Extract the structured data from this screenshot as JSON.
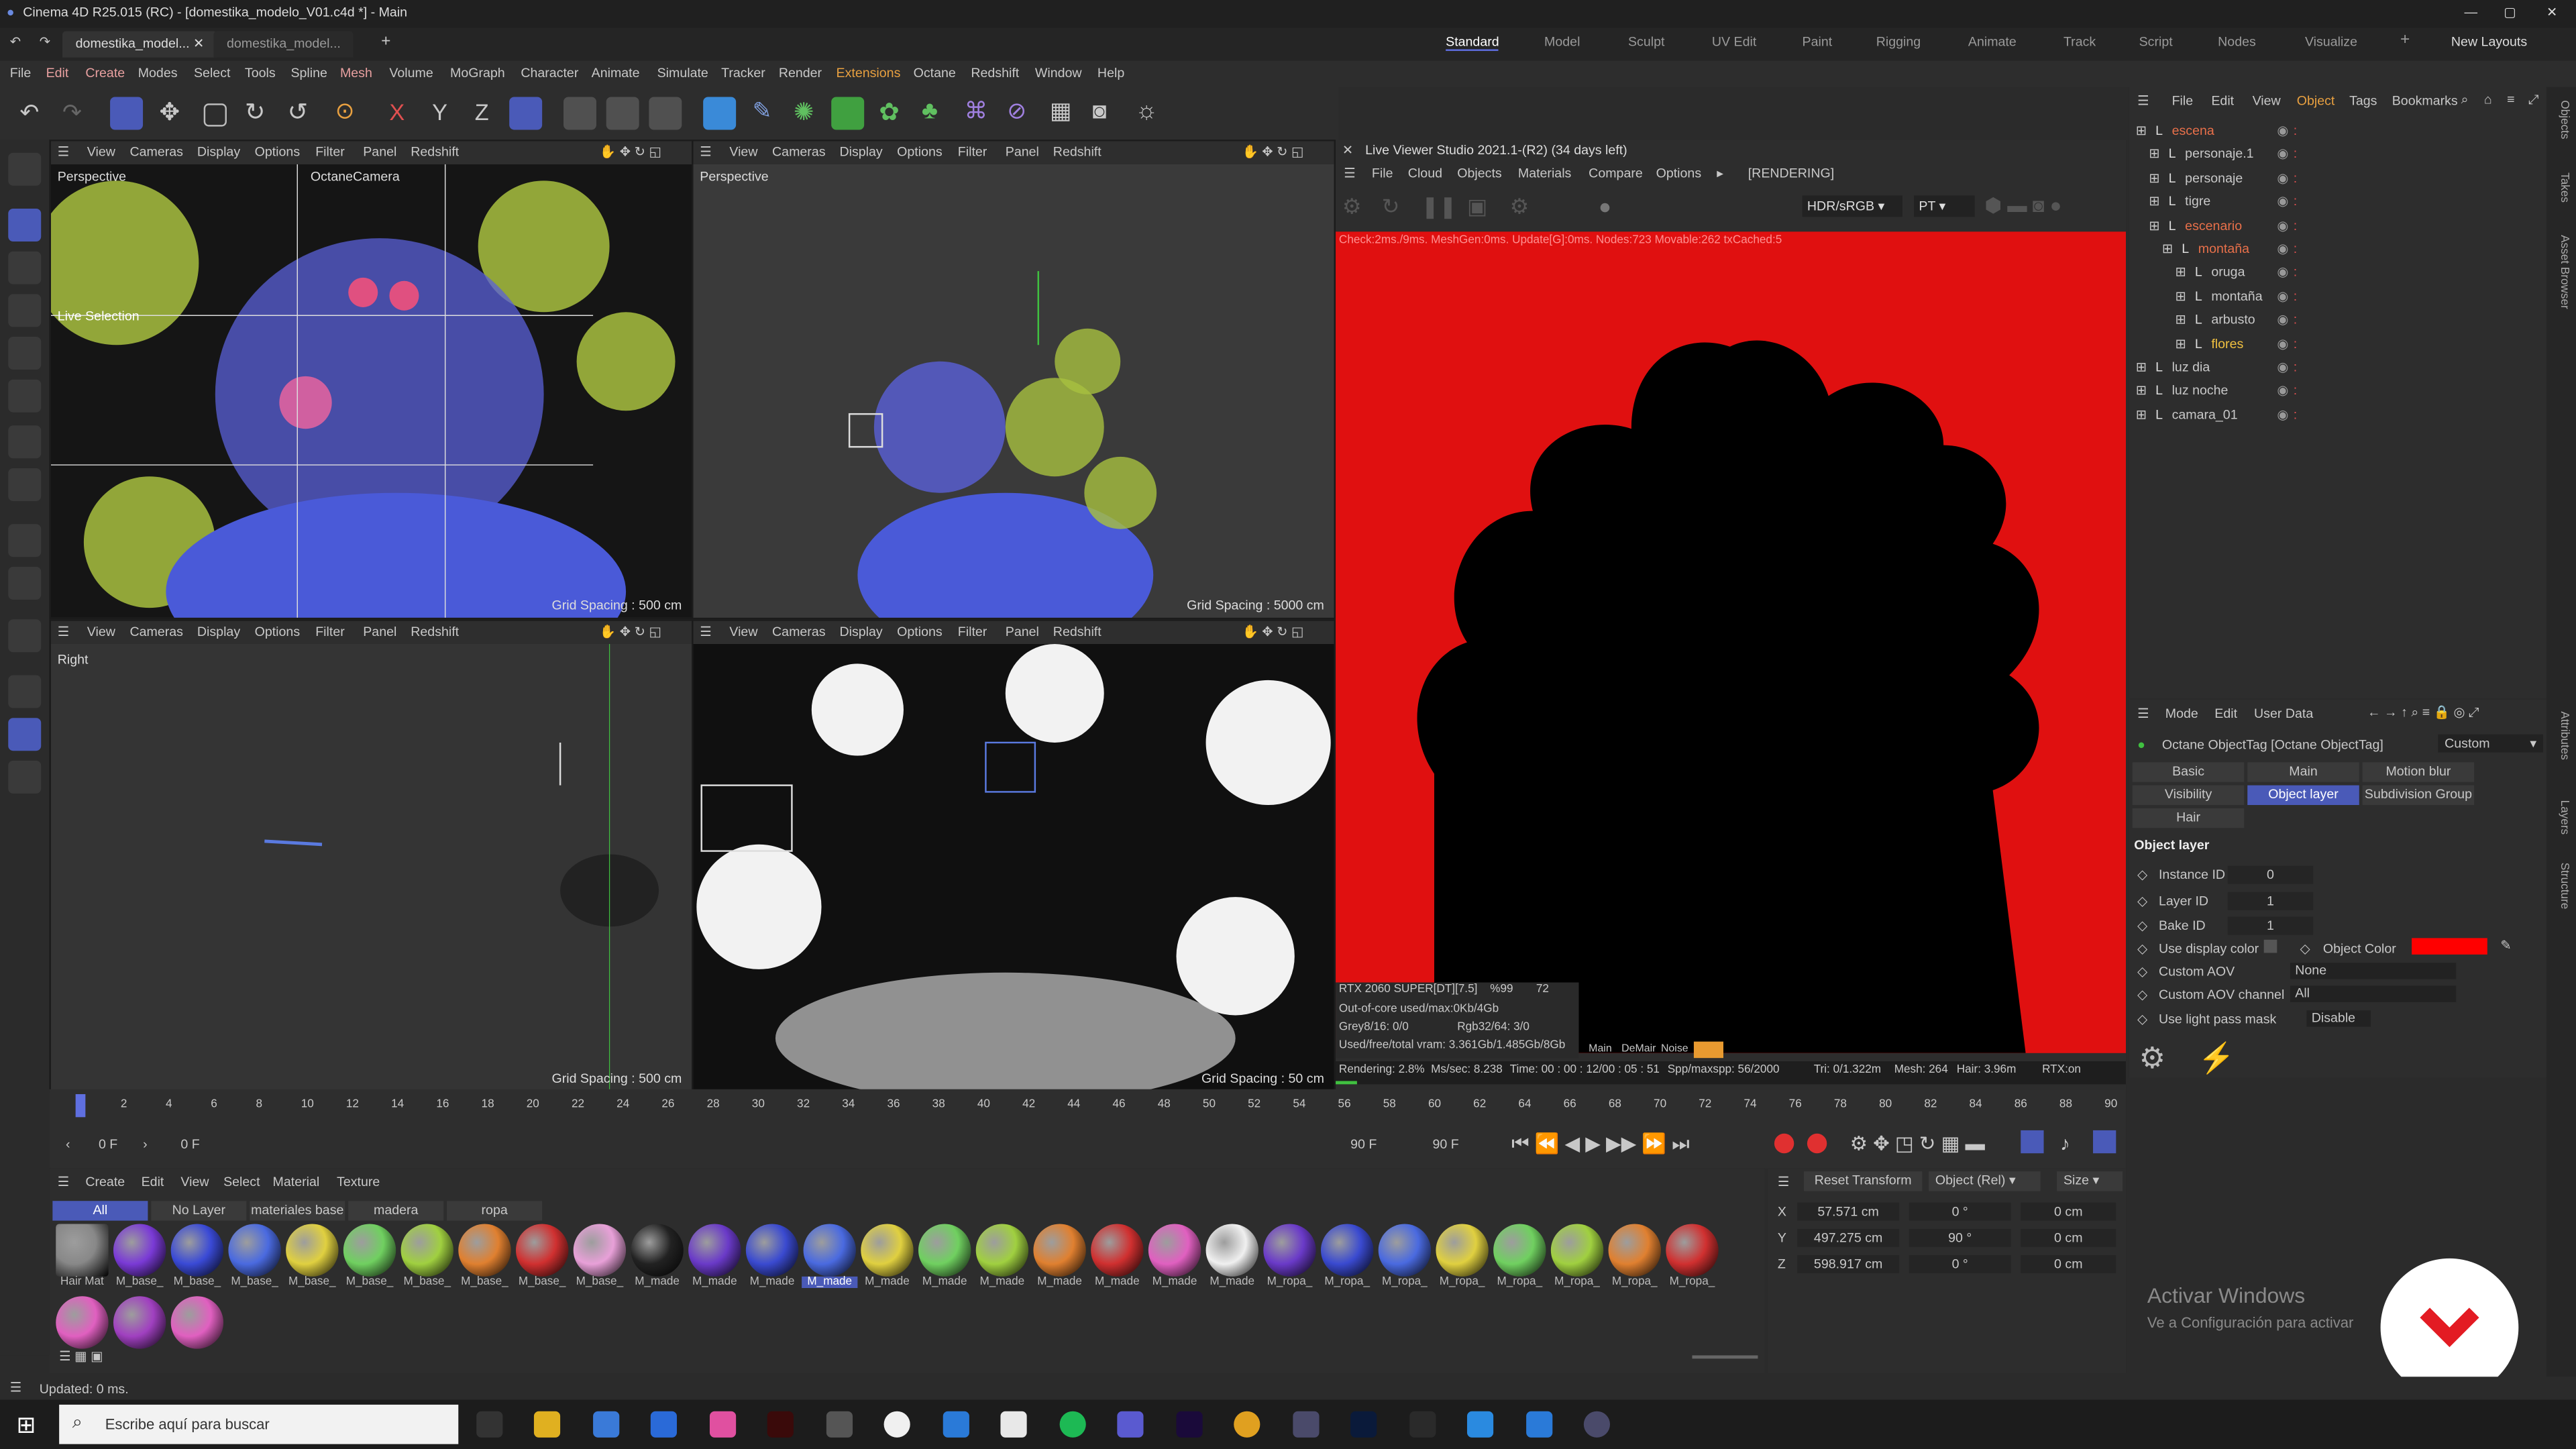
{
  "window": {
    "title": "Cinema 4D R25.015 (RC) - [domestika_modelo_V01.c4d *] - Main"
  },
  "doc_tabs": [
    "domestika_model...",
    "domestika_model..."
  ],
  "layouts": [
    "Standard",
    "Model",
    "Sculpt",
    "UV Edit",
    "Paint",
    "Rigging",
    "Animate",
    "Track",
    "Script",
    "Nodes",
    "Visualize",
    "New Layouts"
  ],
  "menu": [
    "File",
    "Edit",
    "Create",
    "Modes",
    "Select",
    "Tools",
    "Spline",
    "Mesh",
    "Volume",
    "MoGraph",
    "Character",
    "Animate",
    "Simulate",
    "Tracker",
    "Render",
    "Extensions",
    "Octane",
    "Redshift",
    "Window",
    "Help"
  ],
  "viewport_menu": [
    "View",
    "Cameras",
    "Display",
    "Options",
    "Filter",
    "Panel",
    "Redshift"
  ],
  "viewports": [
    {
      "label": "Perspective",
      "camera": "OctaneCamera",
      "grid": "Grid Spacing : 500 cm",
      "hint": "Live Selection"
    },
    {
      "label": "Perspective",
      "grid": "Grid Spacing : 5000 cm"
    },
    {
      "label": "Right",
      "grid": "Grid Spacing : 500 cm"
    },
    {
      "label": "",
      "grid": "Grid Spacing : 50 cm"
    }
  ],
  "lvs": {
    "title": "Live Viewer Studio 2021.1-(R2) (34 days left)",
    "menu": [
      "File",
      "Cloud",
      "Objects",
      "Materials",
      "Compare",
      "Options"
    ],
    "status": "[RENDERING]",
    "colorspace": "HDR/sRGB",
    "mode": "PT",
    "check": "Check:2ms./9ms. MeshGen:0ms. Update[G]:0ms. Nodes:723 Movable:262 txCached:5",
    "gpu": "RTX 2060 SUPER[DT][7.5]",
    "gpu_pct": "%99",
    "gpu_temp": "72",
    "outofcore": "Out-of-core used/max:0Kb/4Gb",
    "grey": "Grey8/16: 0/0",
    "rgb": "Rgb32/64: 3/0",
    "vram": "Used/free/total vram: 3.361Gb/1.485Gb/8Gb",
    "modes": [
      "Main",
      "DeMair",
      "Noise"
    ],
    "rendering": "Rendering: 2.8%",
    "mssec": "Ms/sec: 8.238",
    "time": "Time: 00 : 00 : 12/00 : 05 : 51",
    "spp": "Spp/maxspp: 56/2000",
    "tri": "Tri: 0/1.322m",
    "mesh": "Mesh: 264",
    "hair": "Hair: 3.96m",
    "rtx": "RTX:on"
  },
  "objmgr": {
    "menu": [
      "File",
      "Edit",
      "View",
      "Object",
      "Tags",
      "Bookmarks"
    ],
    "items": [
      {
        "name": "escena",
        "indent": 0,
        "color": "#e8704a"
      },
      {
        "name": "personaje.1",
        "indent": 1,
        "color": "#c8c8c8"
      },
      {
        "name": "personaje",
        "indent": 1,
        "color": "#c8c8c8"
      },
      {
        "name": "tigre",
        "indent": 1,
        "color": "#c8c8c8"
      },
      {
        "name": "escenario",
        "indent": 1,
        "color": "#e8704a"
      },
      {
        "name": "montaña",
        "indent": 2,
        "color": "#e8704a"
      },
      {
        "name": "oruga",
        "indent": 3,
        "color": "#c8c8c8"
      },
      {
        "name": "montaña",
        "indent": 3,
        "color": "#c8c8c8"
      },
      {
        "name": "arbusto",
        "indent": 3,
        "color": "#c8c8c8"
      },
      {
        "name": "flores",
        "indent": 3,
        "color": "#f0c040"
      },
      {
        "name": "luz dia",
        "indent": 0,
        "color": "#c8c8c8"
      },
      {
        "name": "luz noche",
        "indent": 0,
        "color": "#c8c8c8"
      },
      {
        "name": "camara_01",
        "indent": 0,
        "color": "#c8c8c8"
      }
    ]
  },
  "attr": {
    "menu": [
      "Mode",
      "Edit",
      "User Data"
    ],
    "tag": "Octane ObjectTag [Octane ObjectTag]",
    "preset": "Custom",
    "tabs": [
      "Basic",
      "Main",
      "Motion blur",
      "Visibility",
      "Object layer",
      "Subdivision Group",
      "Hair"
    ],
    "section": "Object layer",
    "fields": [
      {
        "label": "Instance ID",
        "value": "0"
      },
      {
        "label": "Layer ID",
        "value": "1"
      },
      {
        "label": "Bake ID",
        "value": "1"
      }
    ],
    "use_display_color": "Use display color",
    "object_color": "Object Color",
    "custom_aov": "Custom AOV",
    "custom_aov_value": "None",
    "custom_aov_channel": "Custom AOV channel",
    "custom_aov_channel_value": "All",
    "light_pass": "Use light pass mask",
    "light_pass_value": "Disable"
  },
  "timeline": {
    "ticks": [
      "0",
      "2",
      "4",
      "6",
      "8",
      "10",
      "12",
      "14",
      "16",
      "18",
      "20",
      "22",
      "24",
      "26",
      "28",
      "30",
      "32",
      "34",
      "36",
      "38",
      "40",
      "42",
      "44",
      "46",
      "48",
      "50",
      "52",
      "54",
      "56",
      "58",
      "60",
      "62",
      "64",
      "66",
      "68",
      "70",
      "72",
      "74",
      "76",
      "78",
      "80",
      "82",
      "84",
      "86",
      "88",
      "90"
    ],
    "start": "0 F",
    "current": "0 F",
    "end_a": "90 F",
    "end_b": "90 F"
  },
  "matmgr": {
    "menu": [
      "Create",
      "Edit",
      "View",
      "Select",
      "Material",
      "Texture"
    ],
    "filters": [
      "All",
      "No Layer",
      "materiales base",
      "madera",
      "ropa"
    ],
    "materials": [
      {
        "name": "Hair Mat",
        "color": "#888888"
      },
      {
        "name": "M_base_",
        "color": "#7a3ad6"
      },
      {
        "name": "M_base_",
        "color": "#3a4ad6"
      },
      {
        "name": "M_base_",
        "color": "#4a6ae0"
      },
      {
        "name": "M_base_",
        "color": "#e0d040"
      },
      {
        "name": "M_base_",
        "color": "#70d060"
      },
      {
        "name": "M_base_",
        "color": "#a0d040"
      },
      {
        "name": "M_base_",
        "color": "#e08030"
      },
      {
        "name": "M_base_",
        "color": "#d03030"
      },
      {
        "name": "M_base_",
        "color": "#e8a0d8"
      },
      {
        "name": "M_made",
        "color": "#222222"
      },
      {
        "name": "M_made",
        "color": "#6a3ac8"
      },
      {
        "name": "M_made",
        "color": "#3a4ad0"
      },
      {
        "name": "M_made",
        "color": "#4a6ae0"
      },
      {
        "name": "M_made",
        "color": "#e0d040"
      },
      {
        "name": "M_made",
        "color": "#70d060"
      },
      {
        "name": "M_made",
        "color": "#a0d040"
      },
      {
        "name": "M_made",
        "color": "#e08030"
      },
      {
        "name": "M_made",
        "color": "#d03030"
      },
      {
        "name": "M_made",
        "color": "#e060c0"
      },
      {
        "name": "M_made",
        "color": "#f0f0f0"
      },
      {
        "name": "M_ropa_",
        "color": "#6a3ac8"
      },
      {
        "name": "M_ropa_",
        "color": "#3a4ad0"
      },
      {
        "name": "M_ropa_",
        "color": "#4a6ae0"
      },
      {
        "name": "M_ropa_",
        "color": "#e0d040"
      },
      {
        "name": "M_ropa_",
        "color": "#70d060"
      },
      {
        "name": "M_ropa_",
        "color": "#a0d040"
      },
      {
        "name": "M_ropa_",
        "color": "#e08030"
      },
      {
        "name": "M_ropa_",
        "color": "#d03030"
      }
    ],
    "row2": [
      "#e060c0",
      "#a040c0",
      "#e060c0"
    ]
  },
  "coords": {
    "reset": "Reset Transform",
    "mode": "Object (Rel)",
    "size": "Size",
    "rows": [
      {
        "axis": "X",
        "pos": "57.571 cm",
        "rot": "0 °",
        "size": "0 cm"
      },
      {
        "axis": "Y",
        "pos": "497.275 cm",
        "rot": "90 °",
        "size": "0 cm"
      },
      {
        "axis": "Z",
        "pos": "598.917 cm",
        "rot": "0 °",
        "size": "0 cm"
      }
    ]
  },
  "watermark": {
    "title": "Activar Windows",
    "sub": "Ve a Configuración para activar"
  },
  "status": "Updated: 0 ms.",
  "taskbar": {
    "search": "Escribe aquí para buscar"
  },
  "side_tabs": [
    "Objects",
    "Takes",
    "Asset Browser",
    "Attributes",
    "Layers",
    "Structure"
  ],
  "colors": {
    "accent": "#5f6fe0",
    "render_bg": "#e01010",
    "orange": "#e8704a"
  }
}
